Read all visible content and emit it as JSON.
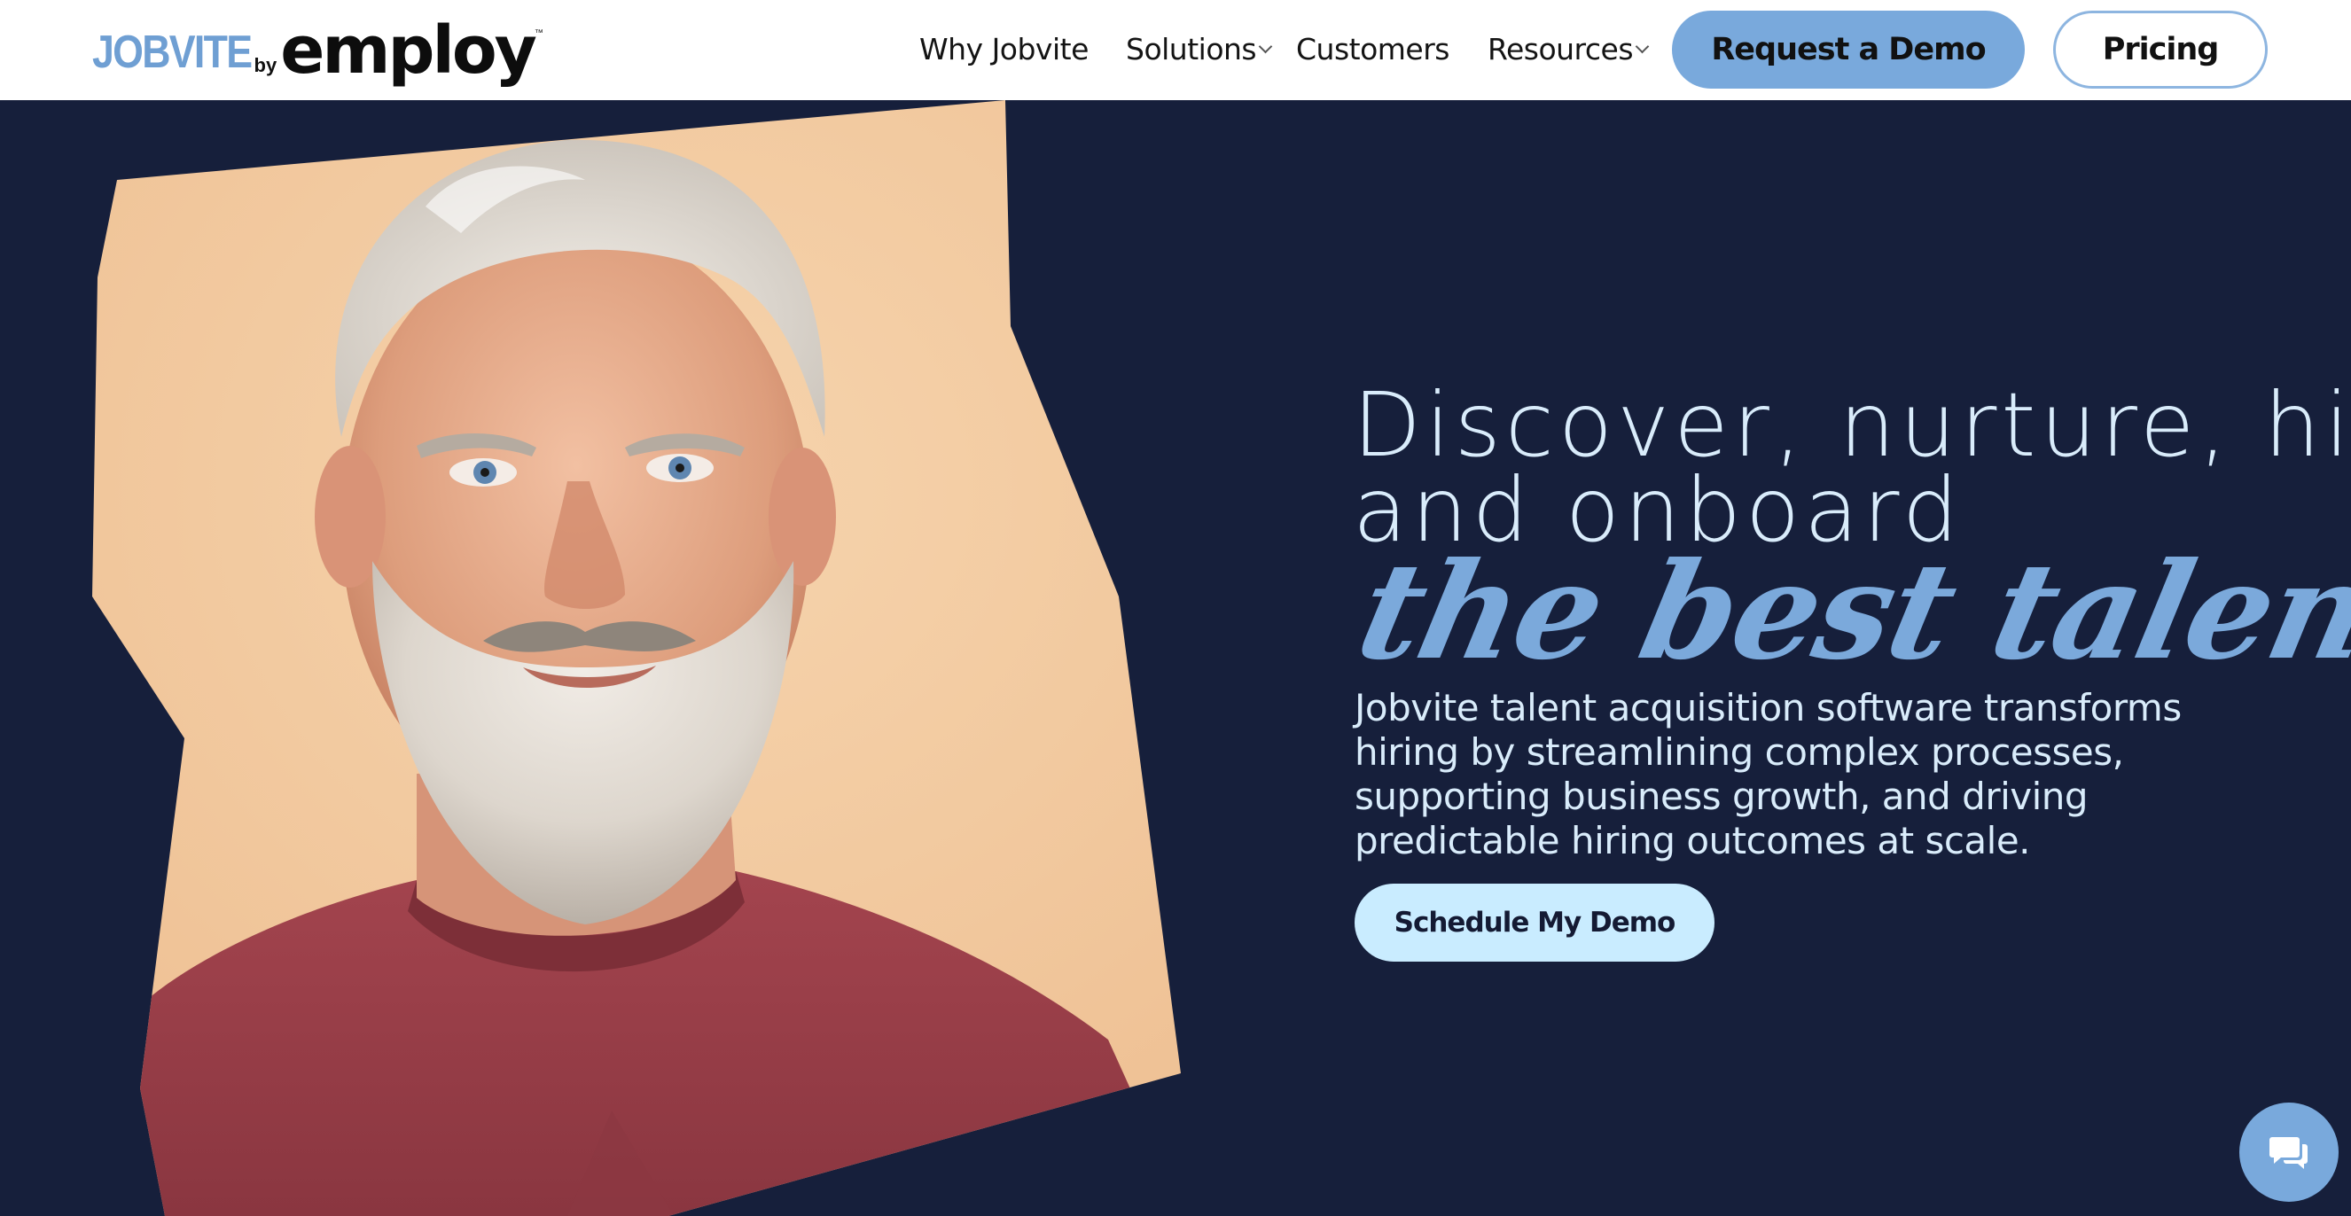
{
  "header": {
    "logo": {
      "primary": "JOBVITE",
      "connector": "by",
      "secondary": "employ",
      "trademark": "™"
    },
    "nav": [
      {
        "label": "Why Jobvite",
        "has_dropdown": false
      },
      {
        "label": "Solutions",
        "has_dropdown": true
      },
      {
        "label": "Customers",
        "has_dropdown": false
      },
      {
        "label": "Resources",
        "has_dropdown": true
      }
    ],
    "request_demo_label": "Request a Demo",
    "pricing_label": "Pricing"
  },
  "hero": {
    "headline_line1": "Discover, nurture, hire,",
    "headline_line2": "and onboard",
    "headline_script": "the best talent",
    "subcopy": "Jobvite talent acquisition software transforms hiring by streamlining complex processes, supporting business growth, and driving predictable hiring outcomes at scale.",
    "cta_label": "Schedule My Demo"
  },
  "colors": {
    "background": "#161f3b",
    "accent_blue": "#79a9dc",
    "light_text": "#d9ecfb",
    "cta_light": "#c9ecff",
    "photo_backdrop": "#f2caa0",
    "sweater": "#983e47"
  },
  "icons": {
    "chat": "chat-bubble-icon",
    "dropdown": "chevron-down-icon"
  }
}
